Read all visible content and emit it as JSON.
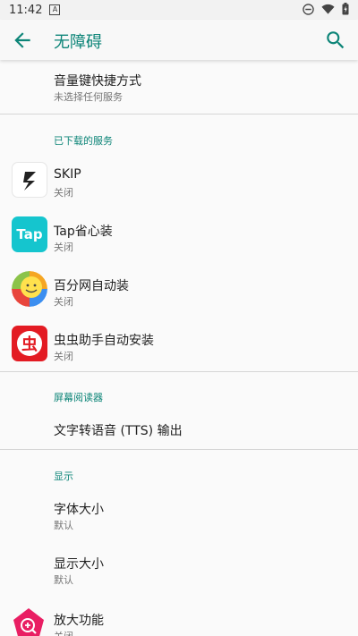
{
  "status": {
    "time": "11:42"
  },
  "appbar": {
    "title": "无障碍"
  },
  "items": {
    "volume_shortcut": {
      "title": "音量键快捷方式",
      "summary": "未选择任何服务"
    },
    "downloaded_header": "已下载的服务",
    "skip": {
      "title": "SKIP",
      "summary": "关闭"
    },
    "tap": {
      "title": "Tap省心装",
      "summary": "关闭",
      "icon_text": "Tap"
    },
    "baidu": {
      "title": "百分网自动装",
      "summary": "关闭"
    },
    "chongchong": {
      "title": "虫虫助手自动安装",
      "summary": "关闭",
      "icon_text": "虫"
    },
    "screen_reader_header": "屏幕阅读器",
    "tts": {
      "title": "文字转语音 (TTS) 输出"
    },
    "display_header": "显示",
    "font_size": {
      "title": "字体大小",
      "summary": "默认"
    },
    "display_size": {
      "title": "显示大小",
      "summary": "默认"
    },
    "magnification": {
      "title": "放大功能",
      "summary": "关闭"
    }
  },
  "colors": {
    "accent": "#0d8578",
    "tap_icon_bg": "#15c5ce",
    "chongchong_bg": "#e31b23"
  }
}
